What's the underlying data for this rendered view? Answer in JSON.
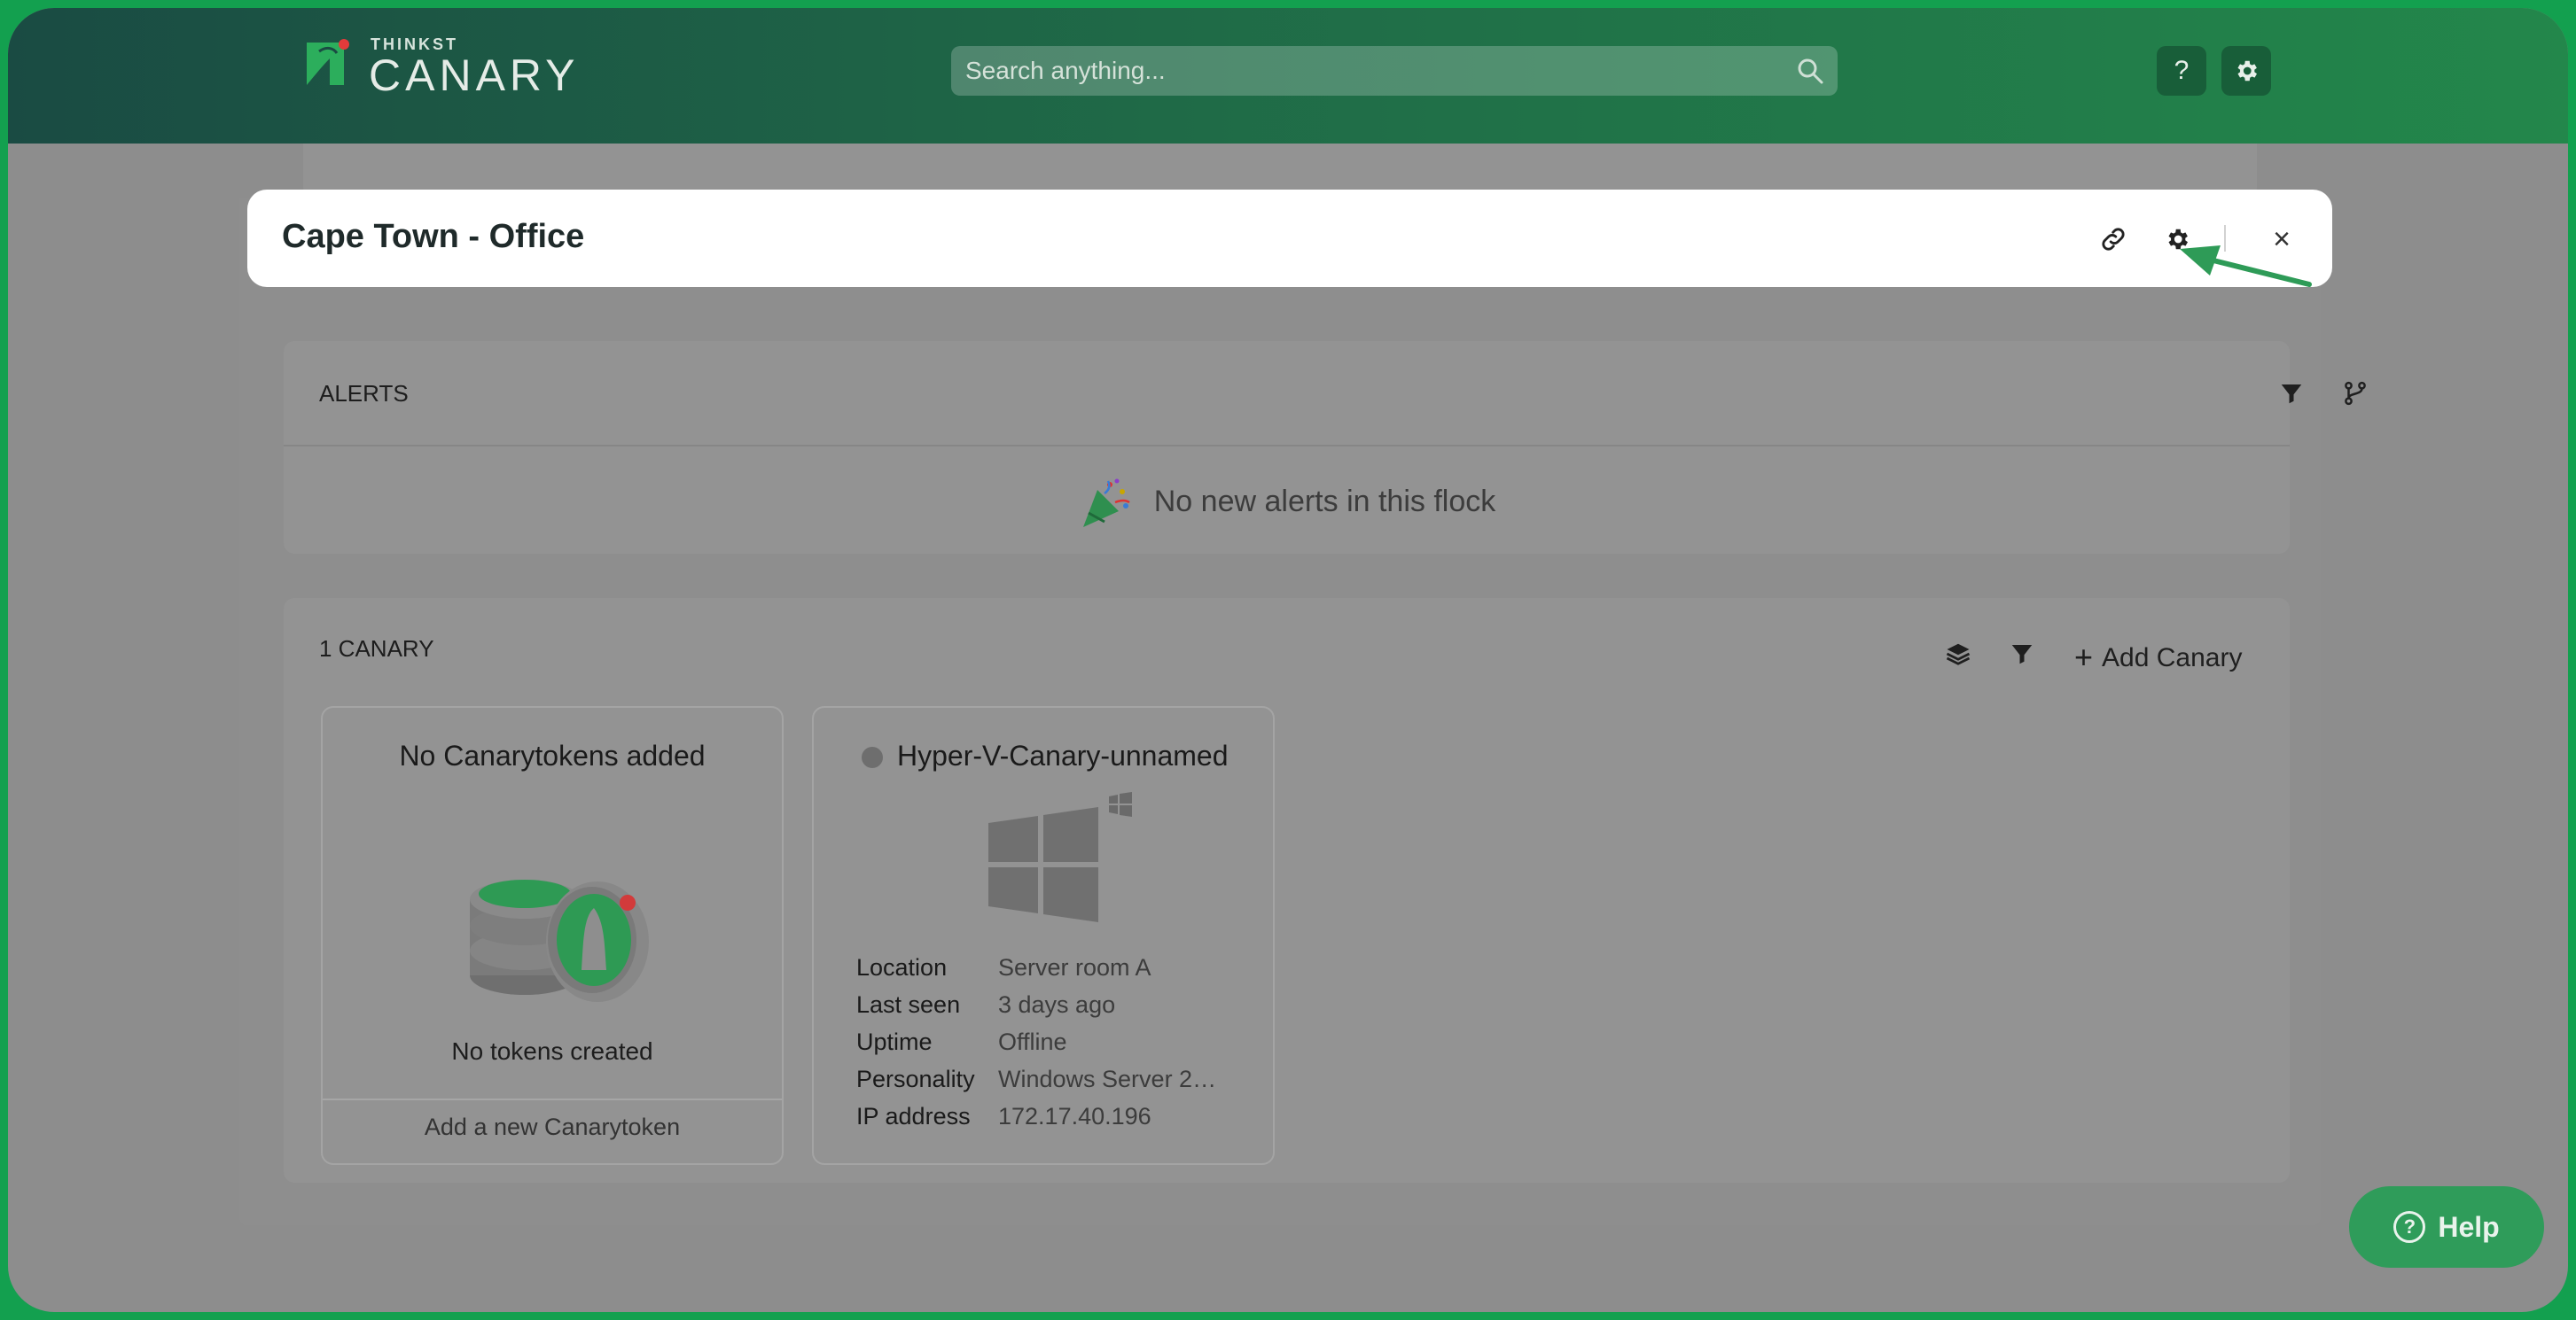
{
  "header": {
    "logo_small": "THINKST",
    "logo_big": "CANARY",
    "search_placeholder": "Search anything...",
    "help_label": "?"
  },
  "modal": {
    "title": "Cape Town - Office",
    "close_label": "×"
  },
  "alerts_panel": {
    "label": "ALERTS",
    "empty_message": "No new alerts in this flock"
  },
  "canary_panel": {
    "label": "1 CANARY",
    "add_label": "Add Canary",
    "tokens_card": {
      "title": "No Canarytokens added",
      "subtitle": "No tokens created",
      "add_label": "Add a new Canarytoken"
    },
    "device_card": {
      "name": "Hyper-V-Canary-unnamed",
      "details": [
        {
          "key": "Location",
          "value": "Server room A"
        },
        {
          "key": "Last seen",
          "value": "3 days ago"
        },
        {
          "key": "Uptime",
          "value": "Offline"
        },
        {
          "key": "Personality",
          "value": "Windows Server 2…"
        },
        {
          "key": "IP address",
          "value": "172.17.40.196"
        }
      ]
    }
  },
  "help_button": {
    "label": "Help"
  },
  "colors": {
    "brand_green": "#23874b",
    "header_dark": "#1a4b43",
    "frame_green": "#13a04f",
    "arrow_green": "#2e9b57"
  }
}
